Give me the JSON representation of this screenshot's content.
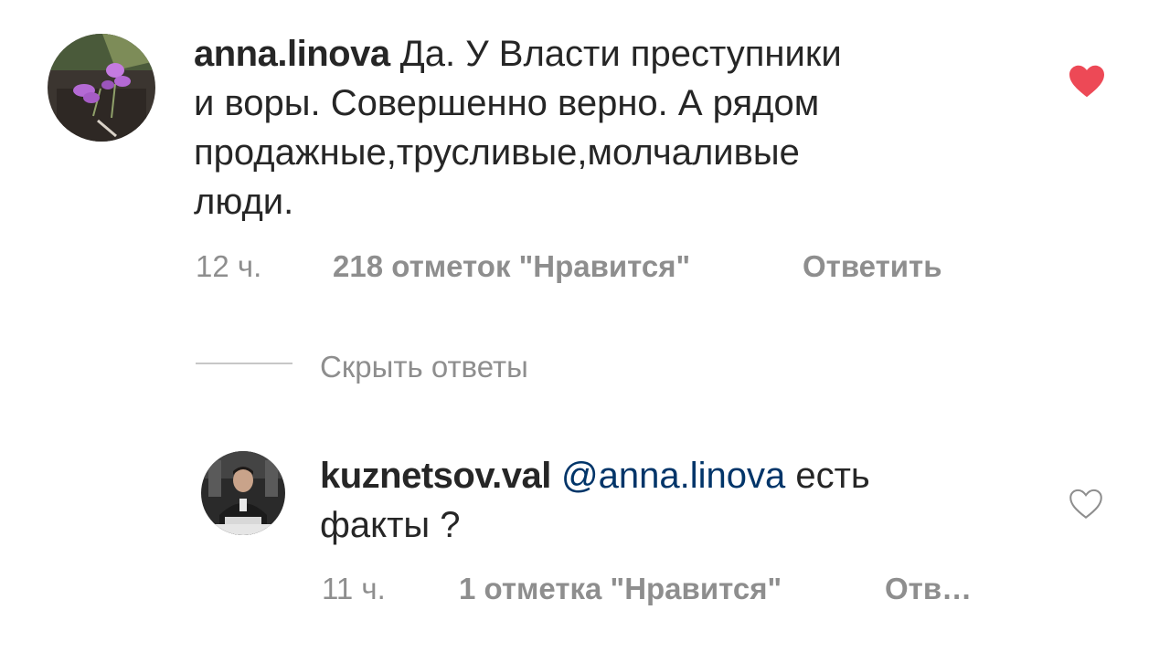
{
  "comment": {
    "username": "anna.linova",
    "text_lines": [
      " Да. У Власти преступники",
      "и воры. Совершенно верно. А рядом",
      "продажные,трусливые,молчаливые",
      "люди."
    ],
    "time": "12 ч.",
    "likes_label": "218 отметок \"Нравится\"",
    "reply_label": "Ответить",
    "liked": true,
    "heart_icon": "heart-filled-icon",
    "heart_color": "#ed4956"
  },
  "toggle": {
    "hide_replies_label": "Скрыть ответы"
  },
  "reply": {
    "username": "kuznetsov.val",
    "mention": "@anna.linova",
    "text_line1_rest": " есть",
    "text_line2": "факты ?",
    "time": "11 ч.",
    "likes_label": "1 отметка \"Нравится\"",
    "reply_label": "Отв…",
    "liked": false,
    "heart_icon": "heart-outline-icon"
  },
  "colors": {
    "text": "#262626",
    "meta": "#8e8e8e",
    "mention": "#003569"
  }
}
